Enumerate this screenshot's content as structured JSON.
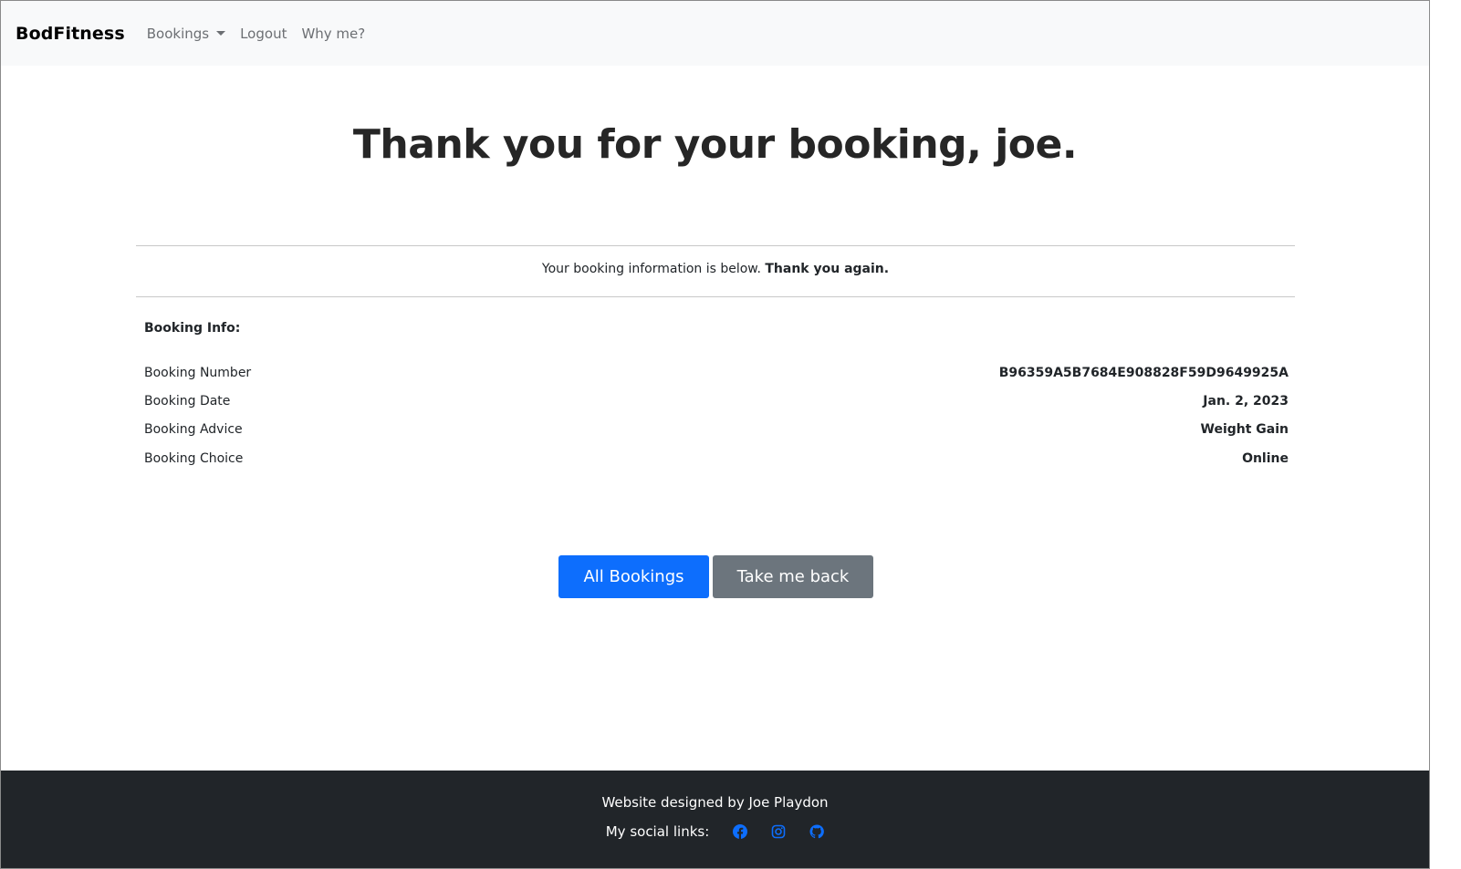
{
  "navbar": {
    "brand": "BodFitness",
    "links": [
      {
        "label": "Bookings",
        "has_dropdown": true
      },
      {
        "label": "Logout"
      },
      {
        "label": "Why me?"
      }
    ]
  },
  "main": {
    "title": "Thank you for your booking, joe.",
    "subtext_plain": "Your booking information is below. ",
    "subtext_bold": "Thank you again.",
    "info_heading": "Booking Info:",
    "rows": [
      {
        "label": "Booking Number",
        "value": "B96359A5B7684E908828F59D9649925A"
      },
      {
        "label": "Booking Date",
        "value": "Jan. 2, 2023"
      },
      {
        "label": "Booking Advice",
        "value": "Weight Gain"
      },
      {
        "label": "Booking Choice",
        "value": "Online"
      }
    ],
    "buttons": {
      "primary": "All Bookings",
      "secondary": "Take me back"
    }
  },
  "footer": {
    "credit": "Website designed by Joe Playdon",
    "social_label": "My social links:",
    "social_icons": [
      "facebook-icon",
      "instagram-icon",
      "github-icon"
    ]
  },
  "colors": {
    "primary": "#0d6efd",
    "secondary": "#6c757d",
    "navbar_bg": "#f8f9fa",
    "footer_bg": "#212529"
  }
}
